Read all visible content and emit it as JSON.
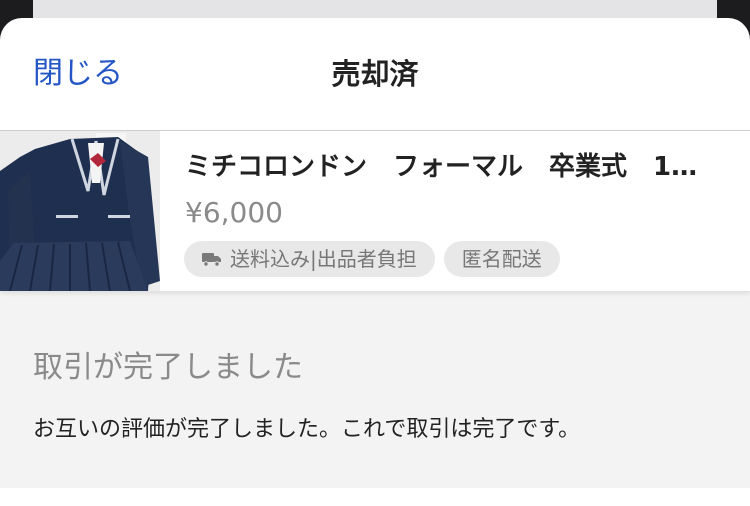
{
  "header": {
    "close_label": "閉じる",
    "title": "売却済"
  },
  "item": {
    "title": "ミチコロンドン　フォーマル　卒業式　1…",
    "price": "¥6,000",
    "tags": [
      {
        "label": "送料込み|出品者負担",
        "icon": "truck-icon"
      },
      {
        "label": "匿名配送"
      }
    ]
  },
  "status": {
    "heading": "取引が完了しました",
    "message": "お互いの評価が完了しました。これで取引は完了です。"
  },
  "colors": {
    "link_blue": "#2556c6",
    "muted_gray": "#8a8a8a",
    "tag_bg": "#e8e8e8",
    "status_bg": "#f3f3f3"
  }
}
